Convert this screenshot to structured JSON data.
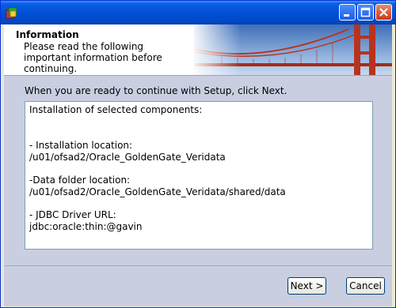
{
  "window": {
    "title": "",
    "controls": [
      "minimize-icon",
      "maximize-icon",
      "close-icon"
    ]
  },
  "banner": {
    "title": "Information",
    "description": "Please read the following important information before continuing."
  },
  "main": {
    "instruction": "When you are ready to continue with Setup, click Next.",
    "info_lines": [
      "Installation of selected components:",
      "- Installation location:",
      "/u01/ofsad2/Oracle_GoldenGate_Veridata",
      "-Data folder location:",
      "/u01/ofsad2/Oracle_GoldenGate_Veridata/shared/data",
      "- JDBC Driver URL:",
      "jdbc:oracle:thin:@gavin"
    ]
  },
  "buttons": {
    "next_label": "Next >",
    "cancel_label": "Cancel"
  },
  "colors": {
    "titlebar": "#0050d8",
    "body_bg": "#c9cfe0",
    "bridge": "#b8331e"
  }
}
